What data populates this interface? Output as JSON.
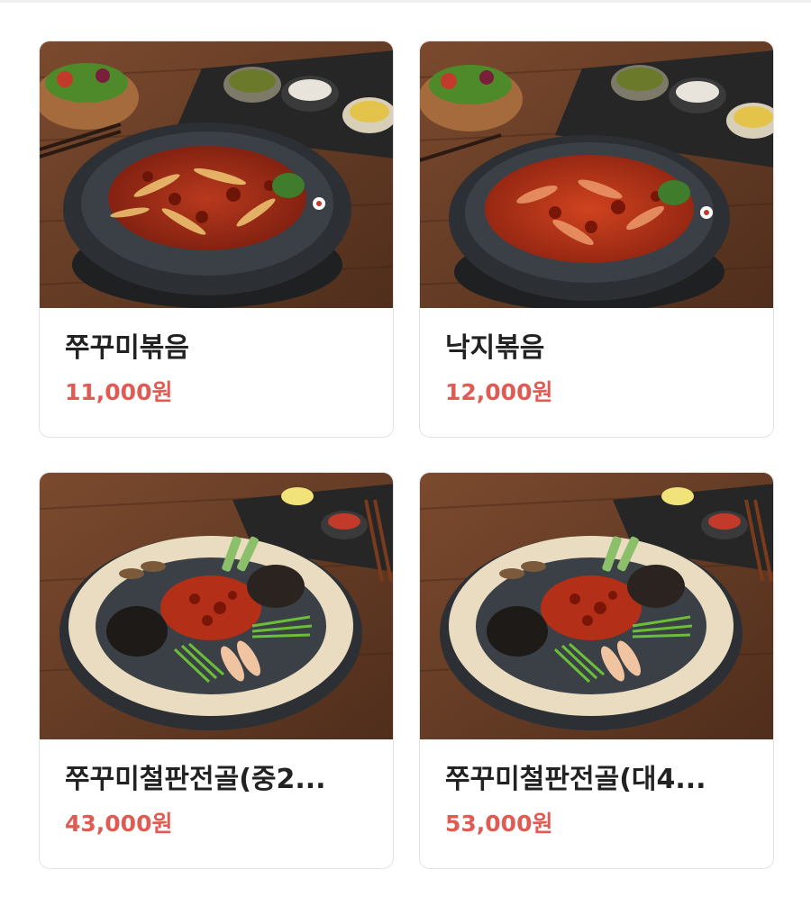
{
  "menu": {
    "items": [
      {
        "name": "쭈꾸미볶음",
        "price": "11,000원",
        "dish": "stir-fry",
        "sauce_color": "#8e2413"
      },
      {
        "name": "낙지볶음",
        "price": "12,000원",
        "dish": "stir-fry",
        "sauce_color": "#b32a16"
      },
      {
        "name": "쭈꾸미철판전골(중2...",
        "price": "43,000원",
        "dish": "hotpot",
        "sauce_color": "#9c2b17"
      },
      {
        "name": "쭈꾸미철판전골(대4...",
        "price": "53,000원",
        "dish": "hotpot",
        "sauce_color": "#9c2b17"
      }
    ]
  },
  "theme": {
    "price_color": "#e05b53",
    "name_color": "#222222",
    "wood_color": "#6a4029",
    "pan_color": "#2c3034"
  }
}
